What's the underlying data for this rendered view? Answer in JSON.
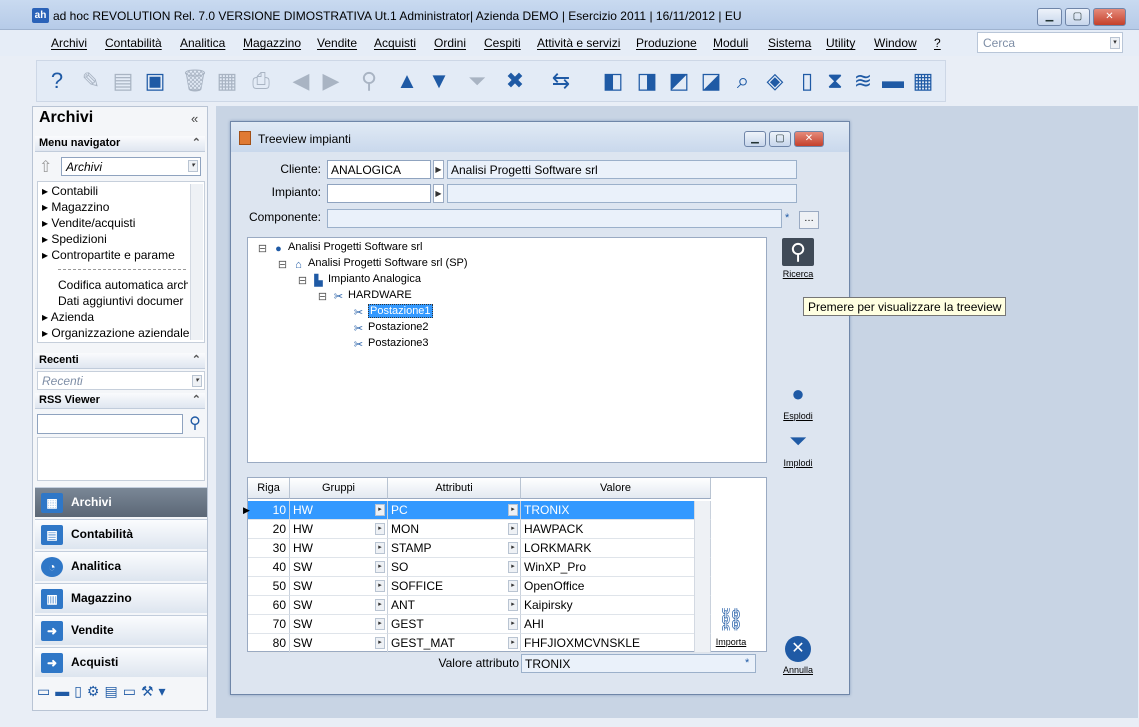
{
  "window": {
    "logo": "ah",
    "title": "ad hoc REVOLUTION Rel. 7.0 VERSIONE DIMOSTRATIVA Ut.1 Administrator| Azienda DEMO | Esercizio 2011 | 16/11/2012 | EU"
  },
  "menu": [
    "Archivi",
    "Contabilità",
    "Analitica",
    "Magazzino",
    "Vendite",
    "Acquisti",
    "Ordini",
    "Cespiti",
    "Attività e servizi",
    "Produzione",
    "Moduli",
    "Sistema",
    "Utility",
    "Window",
    "?"
  ],
  "search": {
    "placeholder": "Cerca"
  },
  "toolbar_icons": [
    "help-icon",
    "edit-icon",
    "new-icon",
    "save-icon",
    "delete-icon",
    "print-preview-icon",
    "print-icon",
    "prev-icon",
    "next-icon",
    "zoom-icon",
    "first-icon",
    "last-icon",
    "filter-icon",
    "cancel-icon",
    "load-icon",
    "calendar-icon"
  ],
  "sidebar": {
    "title": "Archivi",
    "menu_navigator": "Menu navigator",
    "navigator_select": "Archivi",
    "items": [
      "Contabili",
      "Magazzino",
      "Vendite/acquisti",
      "Spedizioni",
      "Contropartite e parame"
    ],
    "items2": [
      "Codifica automatica arch",
      "Dati aggiuntivi documer",
      "Azienda",
      "Organizzazione aziendale"
    ],
    "recenti": "Recenti",
    "recenti_select": "Recenti",
    "rss": "RSS Viewer",
    "nav": [
      "Archivi",
      "Contabilità",
      "Analitica",
      "Magazzino",
      "Vendite",
      "Acquisti"
    ]
  },
  "dialog": {
    "title": "Treeview impianti",
    "cliente_label": "Cliente:",
    "cliente_code": "ANALOGICA",
    "cliente_name": "Analisi Progetti Software srl",
    "impianto_label": "Impianto:",
    "componente_label": "Componente:",
    "tree": [
      {
        "label": "Analisi Progetti Software srl",
        "level": 0,
        "icon": "user"
      },
      {
        "label": "Analisi Progetti Software srl (SP)",
        "level": 1,
        "icon": "home"
      },
      {
        "label": "Impianto Analogica",
        "level": 2,
        "icon": "plant"
      },
      {
        "label": "HARDWARE",
        "level": 3,
        "icon": "tools"
      },
      {
        "label": "Postazione1",
        "level": 4,
        "icon": "tools",
        "selected": true
      },
      {
        "label": "Postazione2",
        "level": 4,
        "icon": "tools"
      },
      {
        "label": "Postazione3",
        "level": 4,
        "icon": "tools"
      }
    ],
    "buttons": {
      "ricerca": "Ricerca",
      "esplodi": "Esplodi",
      "implodi": "Implodi",
      "importa": "Importa",
      "annulla": "Annulla"
    },
    "tooltip": "Premere per visualizzare la treeview",
    "grid": {
      "headers": [
        "Riga",
        "Gruppi",
        "Attributi",
        "Valore"
      ],
      "rows": [
        [
          "10",
          "HW",
          "PC",
          "TRONIX"
        ],
        [
          "20",
          "HW",
          "MON",
          "HAWPACK"
        ],
        [
          "30",
          "HW",
          "STAMP",
          "LORKMARK"
        ],
        [
          "40",
          "SW",
          "SO",
          "WinXP_Pro"
        ],
        [
          "50",
          "SW",
          "SOFFICE",
          "OpenOffice"
        ],
        [
          "60",
          "SW",
          "ANT",
          "Kaipirsky"
        ],
        [
          "70",
          "SW",
          "GEST",
          "AHI"
        ],
        [
          "80",
          "SW",
          "GEST_MAT",
          "FHFJIOXMCVNSKLE"
        ]
      ]
    },
    "valore_label": "Valore attributo",
    "valore_value": "TRONIX"
  }
}
